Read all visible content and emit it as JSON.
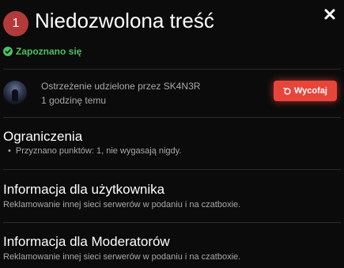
{
  "header": {
    "badge_number": "1",
    "title": "Niedozwolona treść",
    "close_icon": "close-icon"
  },
  "status": {
    "acknowledged_label": "Zapoznano się",
    "icon": "check-circle-icon",
    "color": "#4fbf63"
  },
  "warning": {
    "issued_by": "Ostrzeżenie udzielone przez SK4N3R",
    "time": "1 godzinę temu",
    "revoke_label": "Wycofaj",
    "revoke_icon": "undo-icon",
    "revoke_color": "#e8453a"
  },
  "restrictions": {
    "title": "Ograniczenia",
    "items": [
      "Przyznano punktów: 1, nie wygasają nigdy."
    ]
  },
  "user_info": {
    "title": "Informacja dla użytkownika",
    "text": "Reklamowanie innej sieci serwerów w podaniu i na czatboxie."
  },
  "moderator_info": {
    "title": "Informacja dla Moderatorów",
    "text": "Reklamowanie innej sieci serwerów w podaniu i na czatboxie."
  }
}
